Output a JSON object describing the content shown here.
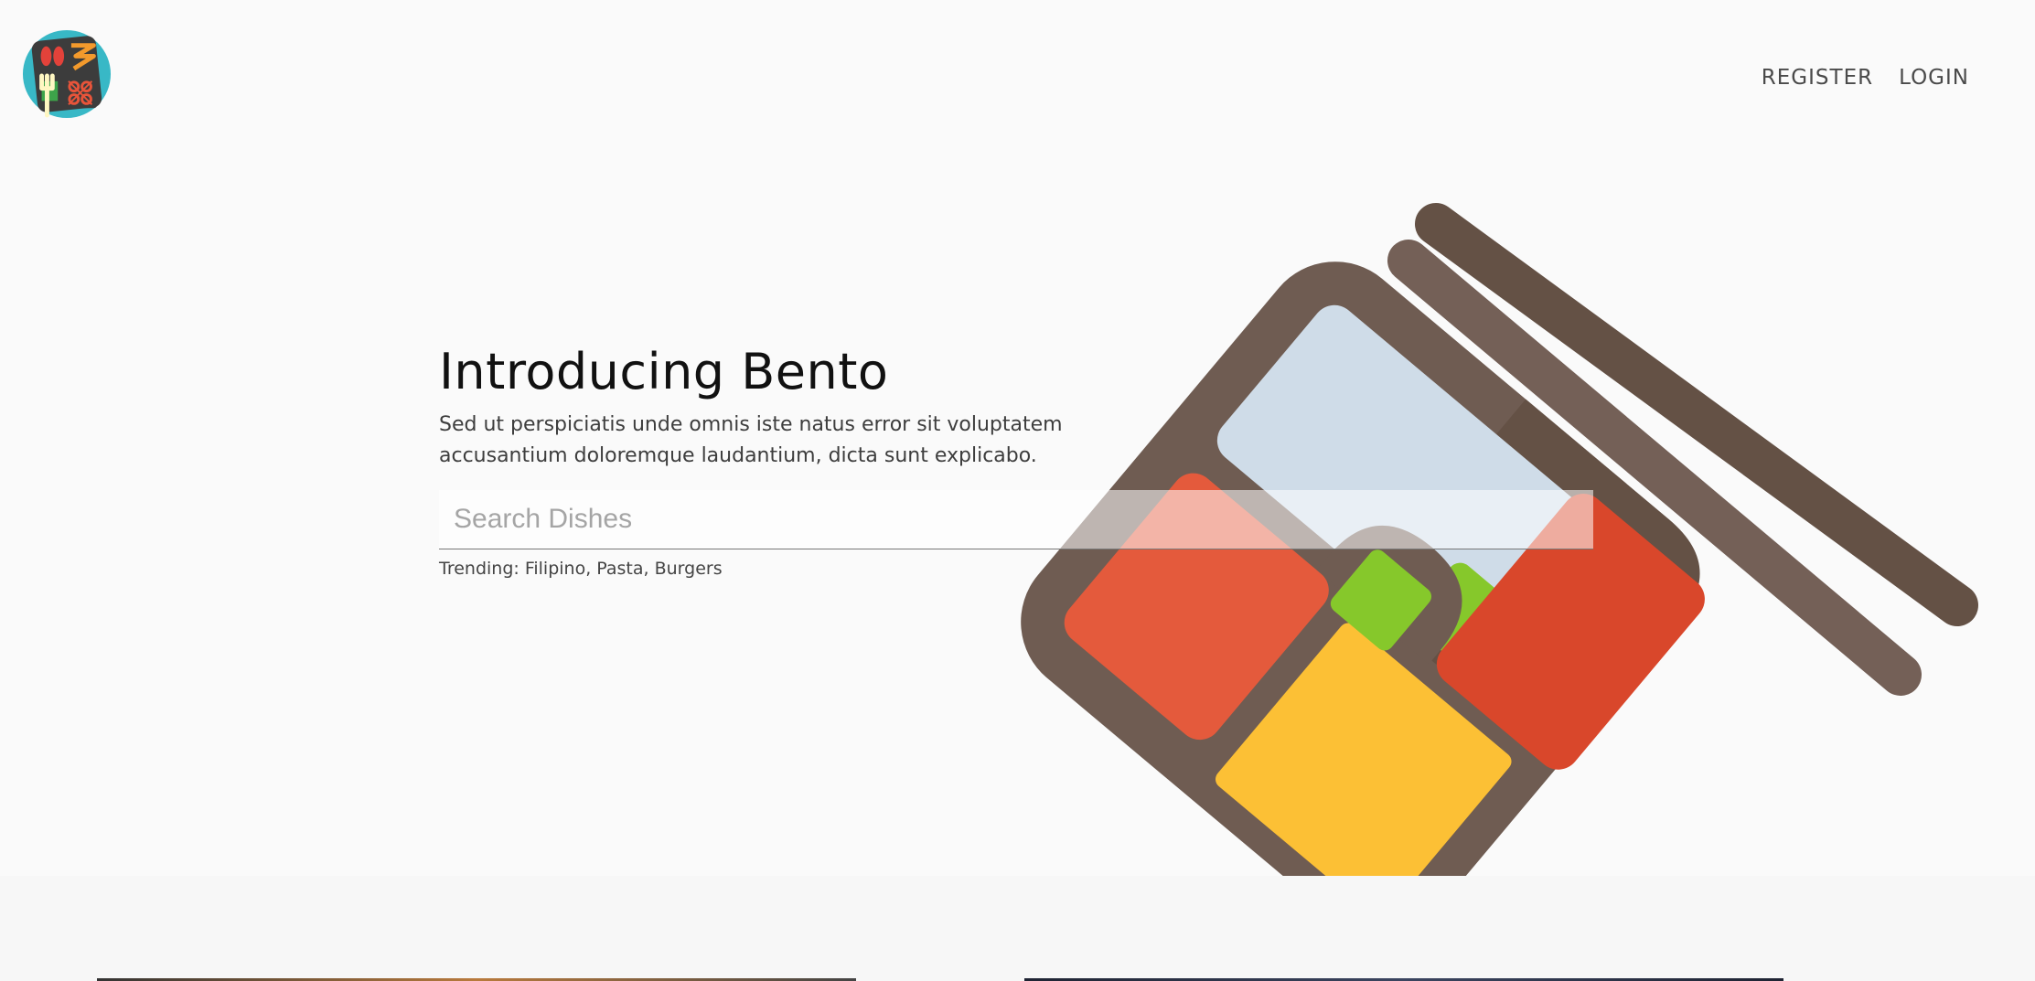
{
  "header": {
    "logo_icon": "bento-logo-icon",
    "nav": {
      "register_label": "REGISTER",
      "login_label": "LOGIN"
    }
  },
  "hero": {
    "title": "Introducing Bento",
    "subtitle": "Sed ut perspiciatis unde omnis iste natus error sit voluptatem accusantium doloremque laudantium, dicta sunt explicabo.",
    "search": {
      "placeholder": "Search Dishes",
      "value": ""
    },
    "trending_text": "Trending: Filipino, Pasta, Burgers",
    "illustration_icon": "bento-box-icon"
  },
  "colors": {
    "background": "#fafafa",
    "bento_brown": "#6f5c52",
    "chopstick_dark": "#645145",
    "chopstick_light": "#746057",
    "rice": "#cfdce8",
    "red": "#e45a3c",
    "red_dark": "#d9472b",
    "green": "#86c82b",
    "yellow": "#fcc035",
    "logo_teal": "#38b8c6"
  }
}
